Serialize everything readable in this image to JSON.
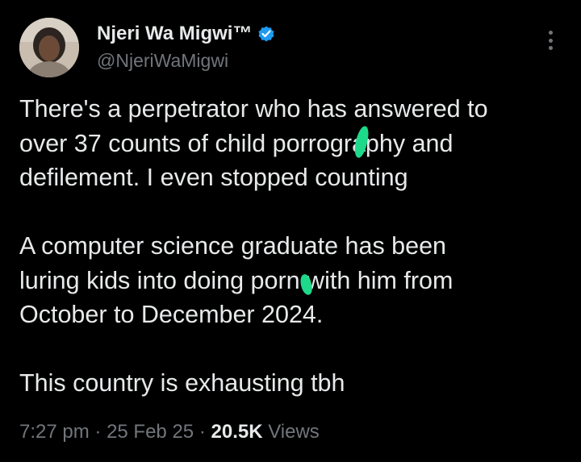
{
  "author": {
    "display_name": "Njeri Wa Migwi™",
    "handle": "@NjeriWaMigwi",
    "verified_icon": "verified-badge-icon",
    "verified_color": "#1d9bf0"
  },
  "tweet": {
    "paragraph1": [
      "There's a perpetrator who has answered to",
      "over 37 counts of child porrography and",
      "defilement. I even stopped counting"
    ],
    "paragraph2": [
      "A computer science graduate has been",
      "luring kids into doing porn with him from",
      "October to December 2024."
    ],
    "paragraph3": [
      "This country is exhausting tbh"
    ]
  },
  "meta": {
    "time": "7:27 pm",
    "separator": "·",
    "date": "25 Feb 25",
    "views_count": "20.5K",
    "views_label": "Views"
  },
  "icons": {
    "more": "more-options-icon"
  },
  "colors": {
    "background": "#000000",
    "text_primary": "#e7e9ea",
    "text_secondary": "#71767b",
    "censor_mark": "#1ed98a"
  }
}
